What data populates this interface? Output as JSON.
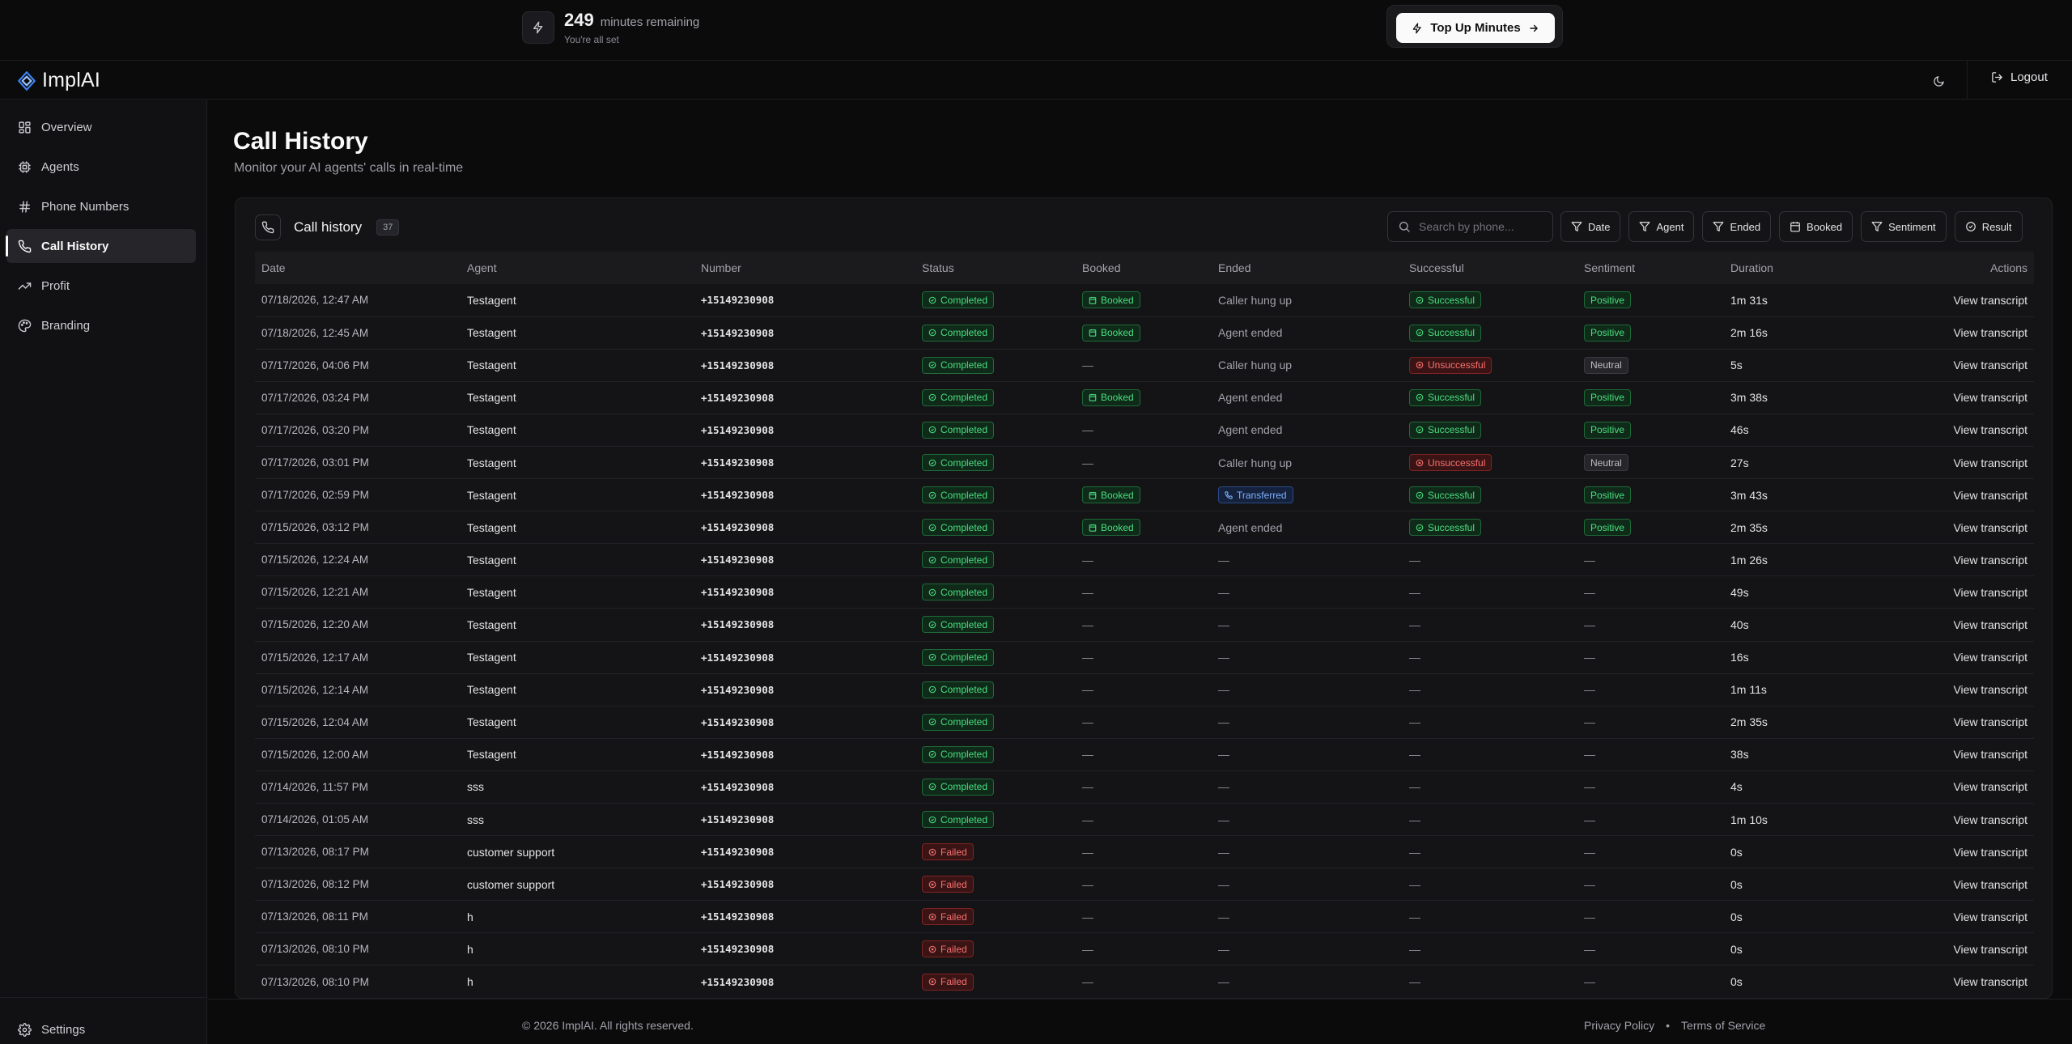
{
  "banner": {
    "minutes": "249",
    "minutes_label": "minutes remaining",
    "status": "You're all set",
    "topup_label": "Top Up Minutes"
  },
  "header": {
    "brand": "ImplAI",
    "logout_label": "Logout"
  },
  "sidebar": {
    "items": [
      {
        "label": "Overview",
        "icon": "grid-icon"
      },
      {
        "label": "Agents",
        "icon": "cpu-icon"
      },
      {
        "label": "Phone Numbers",
        "icon": "hash-icon"
      },
      {
        "label": "Call History",
        "icon": "phone-icon",
        "active": true
      },
      {
        "label": "Profit",
        "icon": "trending-up-icon"
      },
      {
        "label": "Branding",
        "icon": "palette-icon"
      }
    ],
    "settings_label": "Settings"
  },
  "page": {
    "title": "Call History",
    "subtitle": "Monitor your AI agents' calls in real-time"
  },
  "card": {
    "title": "Call history",
    "count": "37",
    "search_placeholder": "Search by phone...",
    "filters": [
      {
        "label": "Date",
        "icon": "filter-icon"
      },
      {
        "label": "Agent",
        "icon": "filter-icon"
      },
      {
        "label": "Ended",
        "icon": "filter-icon"
      },
      {
        "label": "Booked",
        "icon": "calendar-icon"
      },
      {
        "label": "Sentiment",
        "icon": "filter-icon"
      },
      {
        "label": "Result",
        "icon": "check-circle-icon"
      }
    ]
  },
  "table": {
    "columns": [
      "Date",
      "Agent",
      "Number",
      "Status",
      "Booked",
      "Ended",
      "Successful",
      "Sentiment",
      "Duration",
      "Actions"
    ],
    "action_label": "View transcript",
    "rows": [
      {
        "date": "07/18/2026, 12:47 AM",
        "agent": "Testagent",
        "number": "+15149230908",
        "status": "Completed",
        "booked": "Booked",
        "ended": "Caller hung up",
        "successful": "Successful",
        "sentiment": "Positive",
        "duration": "1m 31s"
      },
      {
        "date": "07/18/2026, 12:45 AM",
        "agent": "Testagent",
        "number": "+15149230908",
        "status": "Completed",
        "booked": "Booked",
        "ended": "Agent ended",
        "successful": "Successful",
        "sentiment": "Positive",
        "duration": "2m 16s"
      },
      {
        "date": "07/17/2026, 04:06 PM",
        "agent": "Testagent",
        "number": "+15149230908",
        "status": "Completed",
        "booked": "—",
        "ended": "Caller hung up",
        "successful": "Unsuccessful",
        "sentiment": "Neutral",
        "duration": "5s"
      },
      {
        "date": "07/17/2026, 03:24 PM",
        "agent": "Testagent",
        "number": "+15149230908",
        "status": "Completed",
        "booked": "Booked",
        "ended": "Agent ended",
        "successful": "Successful",
        "sentiment": "Positive",
        "duration": "3m 38s"
      },
      {
        "date": "07/17/2026, 03:20 PM",
        "agent": "Testagent",
        "number": "+15149230908",
        "status": "Completed",
        "booked": "—",
        "ended": "Agent ended",
        "successful": "Successful",
        "sentiment": "Positive",
        "duration": "46s"
      },
      {
        "date": "07/17/2026, 03:01 PM",
        "agent": "Testagent",
        "number": "+15149230908",
        "status": "Completed",
        "booked": "—",
        "ended": "Caller hung up",
        "successful": "Unsuccessful",
        "sentiment": "Neutral",
        "duration": "27s"
      },
      {
        "date": "07/17/2026, 02:59 PM",
        "agent": "Testagent",
        "number": "+15149230908",
        "status": "Completed",
        "booked": "Booked",
        "ended": "Transferred",
        "successful": "Successful",
        "sentiment": "Positive",
        "duration": "3m 43s"
      },
      {
        "date": "07/15/2026, 03:12 PM",
        "agent": "Testagent",
        "number": "+15149230908",
        "status": "Completed",
        "booked": "Booked",
        "ended": "Agent ended",
        "successful": "Successful",
        "sentiment": "Positive",
        "duration": "2m 35s"
      },
      {
        "date": "07/15/2026, 12:24 AM",
        "agent": "Testagent",
        "number": "+15149230908",
        "status": "Completed",
        "booked": "—",
        "ended": "—",
        "successful": "—",
        "sentiment": "—",
        "duration": "1m 26s"
      },
      {
        "date": "07/15/2026, 12:21 AM",
        "agent": "Testagent",
        "number": "+15149230908",
        "status": "Completed",
        "booked": "—",
        "ended": "—",
        "successful": "—",
        "sentiment": "—",
        "duration": "49s"
      },
      {
        "date": "07/15/2026, 12:20 AM",
        "agent": "Testagent",
        "number": "+15149230908",
        "status": "Completed",
        "booked": "—",
        "ended": "—",
        "successful": "—",
        "sentiment": "—",
        "duration": "40s"
      },
      {
        "date": "07/15/2026, 12:17 AM",
        "agent": "Testagent",
        "number": "+15149230908",
        "status": "Completed",
        "booked": "—",
        "ended": "—",
        "successful": "—",
        "sentiment": "—",
        "duration": "16s"
      },
      {
        "date": "07/15/2026, 12:14 AM",
        "agent": "Testagent",
        "number": "+15149230908",
        "status": "Completed",
        "booked": "—",
        "ended": "—",
        "successful": "—",
        "sentiment": "—",
        "duration": "1m 11s"
      },
      {
        "date": "07/15/2026, 12:04 AM",
        "agent": "Testagent",
        "number": "+15149230908",
        "status": "Completed",
        "booked": "—",
        "ended": "—",
        "successful": "—",
        "sentiment": "—",
        "duration": "2m 35s"
      },
      {
        "date": "07/15/2026, 12:00 AM",
        "agent": "Testagent",
        "number": "+15149230908",
        "status": "Completed",
        "booked": "—",
        "ended": "—",
        "successful": "—",
        "sentiment": "—",
        "duration": "38s"
      },
      {
        "date": "07/14/2026, 11:57 PM",
        "agent": "sss",
        "number": "+15149230908",
        "status": "Completed",
        "booked": "—",
        "ended": "—",
        "successful": "—",
        "sentiment": "—",
        "duration": "4s"
      },
      {
        "date": "07/14/2026, 01:05 AM",
        "agent": "sss",
        "number": "+15149230908",
        "status": "Completed",
        "booked": "—",
        "ended": "—",
        "successful": "—",
        "sentiment": "—",
        "duration": "1m 10s"
      },
      {
        "date": "07/13/2026, 08:17 PM",
        "agent": "customer support",
        "number": "+15149230908",
        "status": "Failed",
        "booked": "—",
        "ended": "—",
        "successful": "—",
        "sentiment": "—",
        "duration": "0s"
      },
      {
        "date": "07/13/2026, 08:12 PM",
        "agent": "customer support",
        "number": "+15149230908",
        "status": "Failed",
        "booked": "—",
        "ended": "—",
        "successful": "—",
        "sentiment": "—",
        "duration": "0s"
      },
      {
        "date": "07/13/2026, 08:11 PM",
        "agent": "h",
        "number": "+15149230908",
        "status": "Failed",
        "booked": "—",
        "ended": "—",
        "successful": "—",
        "sentiment": "—",
        "duration": "0s"
      },
      {
        "date": "07/13/2026, 08:10 PM",
        "agent": "h",
        "number": "+15149230908",
        "status": "Failed",
        "booked": "—",
        "ended": "—",
        "successful": "—",
        "sentiment": "—",
        "duration": "0s"
      },
      {
        "date": "07/13/2026, 08:10 PM",
        "agent": "h",
        "number": "+15149230908",
        "status": "Failed",
        "booked": "—",
        "ended": "—",
        "successful": "—",
        "sentiment": "—",
        "duration": "0s"
      }
    ]
  },
  "footer": {
    "copyright": "© 2026 ImplAI. All rights reserved.",
    "privacy": "Privacy Policy",
    "separator": "•",
    "terms": "Terms of Service"
  },
  "colors": {
    "background": "#0b0b0c",
    "success": "#4ade80",
    "danger": "#f87171",
    "info": "#7fb0ff",
    "accent_logo": "#3b82f6"
  }
}
